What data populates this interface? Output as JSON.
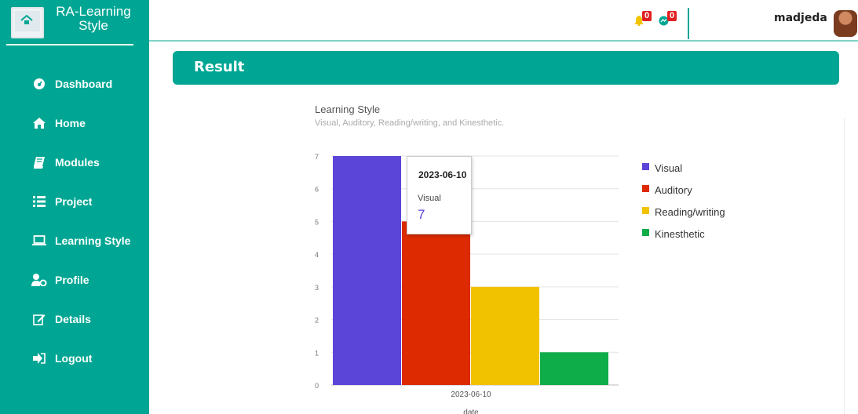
{
  "brand": {
    "title_line1": "RA-Learning",
    "title_line2": "Style"
  },
  "nav": [
    {
      "label": "Dashboard",
      "icon": "dashboard-icon"
    },
    {
      "label": "Home",
      "icon": "home-icon"
    },
    {
      "label": "Modules",
      "icon": "book-icon"
    },
    {
      "label": "Project",
      "icon": "list-icon"
    },
    {
      "label": "Learning Style",
      "icon": "laptop-icon"
    },
    {
      "label": "Profile",
      "icon": "user-cog-icon"
    },
    {
      "label": "Details",
      "icon": "edit-icon"
    },
    {
      "label": "Logout",
      "icon": "logout-icon"
    }
  ],
  "topbar": {
    "notifications_count": "0",
    "messages_count": "0",
    "user_name": "madjeda"
  },
  "page": {
    "header": "Result"
  },
  "chart_data": {
    "type": "bar",
    "title": "Learning Style",
    "subtitle": "Visual, Auditory, Reading/writing, and Kinesthetic.",
    "categories": [
      "2023-06-10"
    ],
    "xlabel": "date",
    "ylim": [
      0,
      7
    ],
    "yticks": [
      "0",
      "1",
      "2",
      "3",
      "4",
      "5",
      "6",
      "7"
    ],
    "series": [
      {
        "name": "Visual",
        "values": [
          7
        ],
        "color": "#5b45d9"
      },
      {
        "name": "Auditory",
        "values": [
          5
        ],
        "color": "#dd2a00"
      },
      {
        "name": "Reading/writing",
        "values": [
          3
        ],
        "color": "#f0c200"
      },
      {
        "name": "Kinesthetic",
        "values": [
          1
        ],
        "color": "#0ead4a"
      }
    ],
    "legend_position": "right",
    "grid": true
  },
  "tooltip": {
    "date": "2023-06-10",
    "series": "Visual",
    "value": "7"
  },
  "colors": {
    "accent": "#00a693",
    "badge": "#e02020"
  }
}
